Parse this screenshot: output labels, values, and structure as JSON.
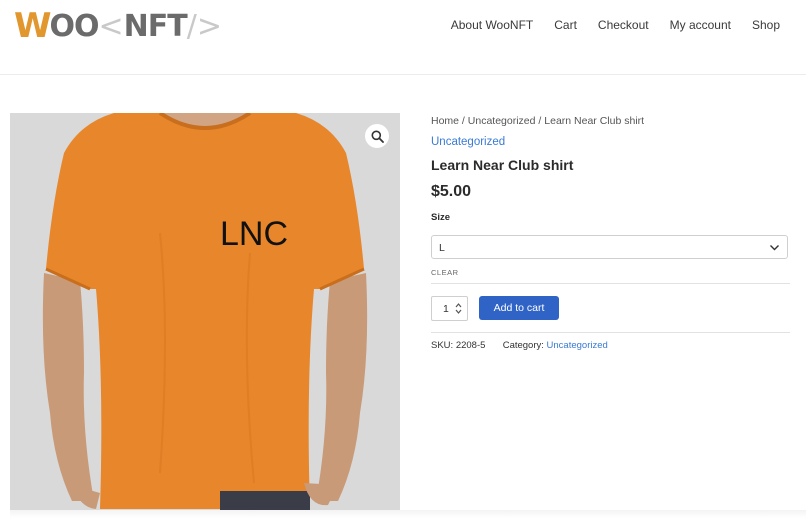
{
  "header": {
    "logo": {
      "w": "W",
      "oo": "OO",
      "open": "<",
      "nft": "NFT",
      "close": "/>"
    },
    "nav": [
      "About WooNFT",
      "Cart",
      "Checkout",
      "My account",
      "Shop"
    ]
  },
  "product": {
    "image": {
      "shirt_text": "LNC",
      "shirt_color": "#e8862b",
      "background": "#d9d9d9"
    },
    "breadcrumb": [
      "Home",
      "Uncategorized",
      "Learn Near Club shirt"
    ],
    "breadcrumb_separator": " / ",
    "category": "Uncategorized",
    "title": "Learn Near Club shirt",
    "price": "$5.00",
    "size_label": "Size",
    "size_value": "L",
    "clear_label": "CLEAR",
    "quantity": "1",
    "add_to_cart_label": "Add to cart",
    "meta": {
      "sku_label": "SKU:",
      "sku": "2208-5",
      "category_label": "Category:",
      "category": "Uncategorized"
    }
  },
  "colors": {
    "accent": "#2f64c6",
    "link": "#3a7bd5",
    "logo_orange": "#e2962e"
  },
  "icons": {
    "zoom": "magnifier-icon",
    "select": "chevron-down-icon",
    "spinner": "stepper-icon"
  }
}
